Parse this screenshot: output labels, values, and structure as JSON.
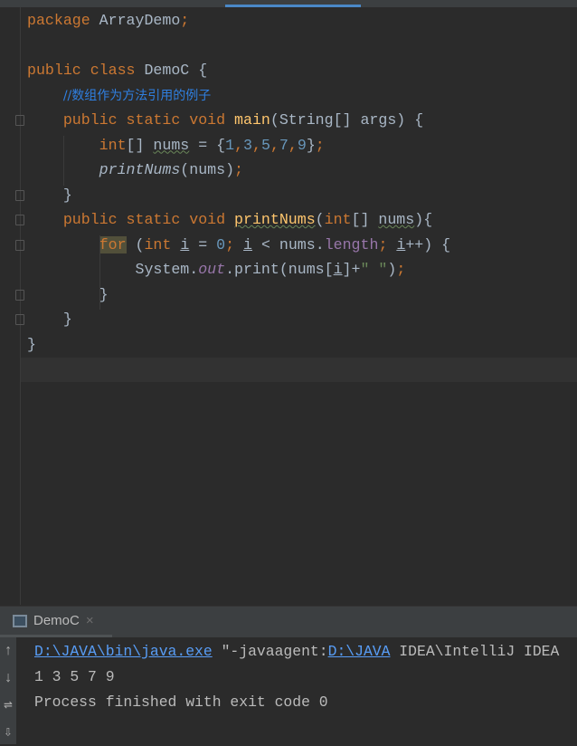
{
  "editor": {
    "lines": [
      [
        [
          "package ",
          "kw"
        ],
        [
          "ArrayDemo",
          ""
        ],
        [
          ";",
          "kw"
        ]
      ],
      [],
      [
        [
          "public class ",
          "kw"
        ],
        [
          "DemoC {",
          ""
        ]
      ],
      [
        [
          "    ",
          ""
        ],
        [
          "//数组作为方法引用的例子",
          "cm"
        ]
      ],
      [
        [
          "    ",
          ""
        ],
        [
          "public static void ",
          "kw"
        ],
        [
          "main",
          "decl"
        ],
        [
          "(String[] args) {",
          ""
        ]
      ],
      [
        [
          "        ",
          ""
        ],
        [
          "int",
          "kw"
        ],
        [
          "[] ",
          ""
        ],
        [
          "nums",
          "wv"
        ],
        [
          " = {",
          ""
        ],
        [
          "1",
          "num"
        ],
        [
          ",",
          "kw"
        ],
        [
          "3",
          "num"
        ],
        [
          ",",
          "kw"
        ],
        [
          "5",
          "num"
        ],
        [
          ",",
          "kw"
        ],
        [
          "7",
          "num"
        ],
        [
          ",",
          "kw"
        ],
        [
          "9",
          "num"
        ],
        [
          "}",
          ""
        ],
        [
          ";",
          "kw"
        ]
      ],
      [
        [
          "        ",
          ""
        ],
        [
          "printNums",
          "it"
        ],
        [
          "(nums)",
          ""
        ],
        [
          ";",
          "kw"
        ]
      ],
      [
        [
          "    }",
          ""
        ]
      ],
      [
        [
          "    ",
          ""
        ],
        [
          "public static void ",
          "kw"
        ],
        [
          "printNums",
          "decl wv"
        ],
        [
          "(",
          ""
        ],
        [
          "int",
          "kw"
        ],
        [
          "[] ",
          ""
        ],
        [
          "nums",
          "wv"
        ],
        [
          "){",
          ""
        ]
      ],
      [
        [
          "        ",
          ""
        ],
        [
          "for",
          "kw hl"
        ],
        [
          " (",
          ""
        ],
        [
          "int ",
          "kw"
        ],
        [
          "i",
          "ul"
        ],
        [
          " = ",
          ""
        ],
        [
          "0",
          "num"
        ],
        [
          "; ",
          "kw"
        ],
        [
          "i",
          "ul"
        ],
        [
          " < nums.",
          ""
        ],
        [
          "length",
          "fld"
        ],
        [
          "; ",
          "kw"
        ],
        [
          "i",
          "ul"
        ],
        [
          "++) {",
          ""
        ]
      ],
      [
        [
          "            System.",
          ""
        ],
        [
          "out",
          "fldit"
        ],
        [
          ".print(nums[",
          ""
        ],
        [
          "i",
          "ul"
        ],
        [
          "]+",
          ""
        ],
        [
          "\" \"",
          "str"
        ],
        [
          ")",
          ""
        ],
        [
          ";",
          "kw"
        ]
      ],
      [
        [
          "        }",
          ""
        ]
      ],
      [
        [
          "    }",
          ""
        ]
      ],
      [
        [
          "}",
          ""
        ]
      ]
    ]
  },
  "run_panel": {
    "tab_label": "DemoC",
    "close": "×",
    "console": {
      "java_path": "D:\\JAVA\\bin\\java.exe",
      "arg_prefix": " \"-javaagent:",
      "agent_path": "D:\\JAVA",
      "arg_rest": " IDEA\\IntelliJ IDEA",
      "output": "1 3 5 7 9",
      "exit": "Process finished with exit code 0"
    },
    "tools": [
      "↑",
      "↓",
      "⇌",
      "⇩"
    ]
  }
}
